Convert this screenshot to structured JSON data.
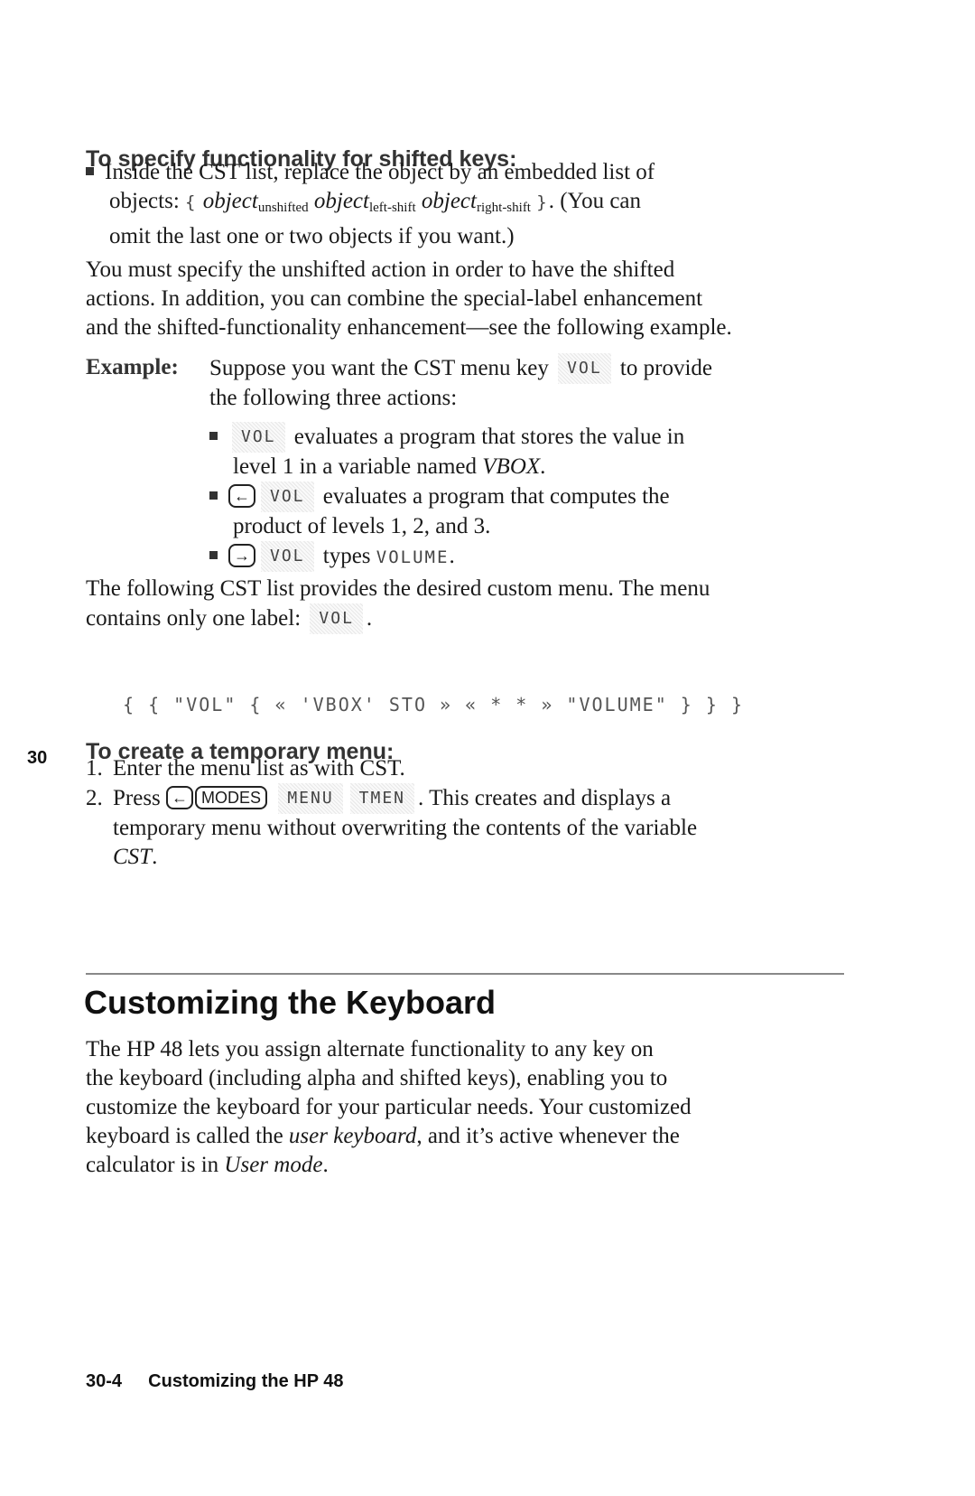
{
  "section_shifted": {
    "heading": "To specify functionality for shifted keys:",
    "bullet_line1": "Inside the CST list, replace the object by an embedded list of",
    "bullet_line2_prefix": "objects:",
    "open_brace": "{",
    "close_brace": "}",
    "obj_word": "object",
    "sub_unshifted": "unshifted",
    "sub_left": "left-shift",
    "sub_right": "right-shift",
    "bullet_line2_suffix": ". (You can",
    "bullet_line3": "omit the last one or two objects if you want.)",
    "para_line1": "You must specify the unshifted action in order to have the shifted",
    "para_line2": "actions. In addition, you can combine the special-label enhancement",
    "para_line3": "and the shifted-functionality enhancement—see the following example."
  },
  "example": {
    "label": "Example:",
    "line1_prefix": "Suppose you want the CST menu key",
    "line1_suffix": "to provide",
    "line2": "the following three actions:",
    "softkey": "VOL",
    "actions": [
      {
        "line1": "evaluates a program that stores the value in",
        "line2_prefix": "level 1 in a variable named",
        "line2_var": "VBOX",
        "line2_suffix": "."
      },
      {
        "key": "left-shift",
        "line1": "evaluates a program that computes the",
        "line2": "product of levels 1, 2, and 3."
      },
      {
        "key": "right-shift",
        "line1": "types",
        "lcd": "VOLUME",
        "end": "."
      }
    ]
  },
  "cst_list": {
    "line1": "The following CST list provides the desired custom menu. The menu",
    "line2_prefix": "contains only one label:",
    "line2_suffix": ".",
    "code": "{ { \"VOL\" { « 'VBOX' STO » « * * » \"VOLUME\" } } }"
  },
  "section_temp": {
    "heading": "To create a temporary menu:",
    "steps": [
      {
        "num": "1.",
        "text": "Enter the menu list as with CST."
      },
      {
        "num": "2.",
        "prefix": "Press",
        "key_modes": "MODES",
        "softkey1": "MENU",
        "softkey2": "TMEN",
        "suffix": ". This creates and displays a",
        "line2": "temporary menu without overwriting the contents of the variable",
        "line3_var": "CST",
        "line3_end": "."
      }
    ]
  },
  "side_tab": "30",
  "keyboard_section": {
    "title": "Customizing the Keyboard",
    "line1": "The HP 48 lets you assign alternate functionality to any key on",
    "line2": "the keyboard (including alpha and shifted keys), enabling you to",
    "line3": "customize the keyboard for your particular needs. Your customized",
    "line4_prefix": "keyboard is called the",
    "line4_em": "user keyboard",
    "line4_suffix": ", and it’s active whenever the",
    "line5_prefix": "calculator is in",
    "line5_em": "User mode",
    "line5_suffix": "."
  },
  "footer": {
    "page": "30-4",
    "title": "Customizing the HP 48"
  },
  "icons": {
    "left_shift": "←",
    "right_shift": "→"
  }
}
